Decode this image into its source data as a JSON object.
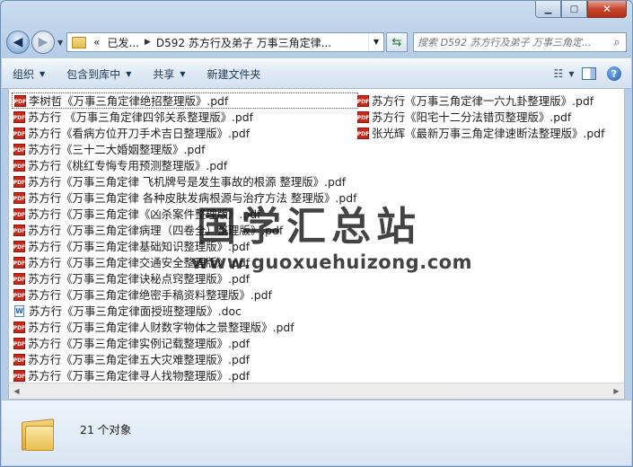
{
  "window": {
    "buttons": [
      "minimize",
      "maximize",
      "close"
    ]
  },
  "address": {
    "overflow": "«",
    "crumbs": [
      "已发...",
      "D592 苏方行及弟子 万事三角定律..."
    ]
  },
  "search": {
    "placeholder": "搜索 D592 苏方行及弟子 万事三角定..."
  },
  "toolbar": {
    "organize": "组织",
    "include_in_library": "包含到库中",
    "share": "共享",
    "new_folder": "新建文件夹"
  },
  "files_col1": [
    {
      "name": "李树哲《万事三角定律绝招整理版》.pdf",
      "type": "pdf"
    },
    {
      "name": "苏方行 《万事三角定律四邻关系整理版》.pdf",
      "type": "pdf"
    },
    {
      "name": "苏方行《看病方位开刀手术吉日整理版》.pdf",
      "type": "pdf"
    },
    {
      "name": "苏方行《三十二大婚姻整理版》.pdf",
      "type": "pdf"
    },
    {
      "name": "苏方行《桃红专悔专用预测整理版》.pdf",
      "type": "pdf"
    },
    {
      "name": "苏方行《万事三角定律 飞机牌号是发生事故的根源 整理版》.pdf",
      "type": "pdf"
    },
    {
      "name": "苏方行《万事三角定律 各种皮肤发病根源与治疗方法 整理版》.pdf",
      "type": "pdf"
    },
    {
      "name": "苏方行《万事三角定律《凶杀案件整理版》.pdf",
      "type": "pdf"
    },
    {
      "name": "苏方行《万事三角定律病理（四卷全）整理版》.pdf",
      "type": "pdf"
    },
    {
      "name": "苏方行《万事三角定律基础知识整理版》.pdf",
      "type": "pdf"
    },
    {
      "name": "苏方行《万事三角定律交通安全整理版》.pdf",
      "type": "pdf"
    },
    {
      "name": "苏方行《万事三角定律诀秘点窍整理版》.pdf",
      "type": "pdf"
    },
    {
      "name": "苏方行《万事三角定律绝密手稿资料整理版》.pdf",
      "type": "pdf"
    },
    {
      "name": "苏方行《万事三角定律面授班整理版》.doc",
      "type": "doc"
    },
    {
      "name": "苏方行《万事三角定律人财数字物体之景整理版》.pdf",
      "type": "pdf"
    },
    {
      "name": "苏方行《万事三角定律实例记载整理版》.pdf",
      "type": "pdf"
    },
    {
      "name": "苏方行《万事三角定律五大灾难整理版》.pdf",
      "type": "pdf"
    },
    {
      "name": "苏方行《万事三角定律寻人找物整理版》.pdf",
      "type": "pdf"
    }
  ],
  "files_col2": [
    {
      "name": "苏方行《万事三角定律一六九卦整理版》.pdf",
      "type": "pdf"
    },
    {
      "name": "苏方行《阳宅十二分法错页整理版》.pdf",
      "type": "pdf"
    },
    {
      "name": "张光辉《最新万事三角定律速断法整理版》.pdf",
      "type": "pdf"
    }
  ],
  "icon_labels": {
    "pdf": "PDF",
    "doc": "W"
  },
  "watermark": {
    "title": "国学汇总站",
    "url": "www.guoxuehuizong.com"
  },
  "status": {
    "count_text": "21 个对象"
  }
}
